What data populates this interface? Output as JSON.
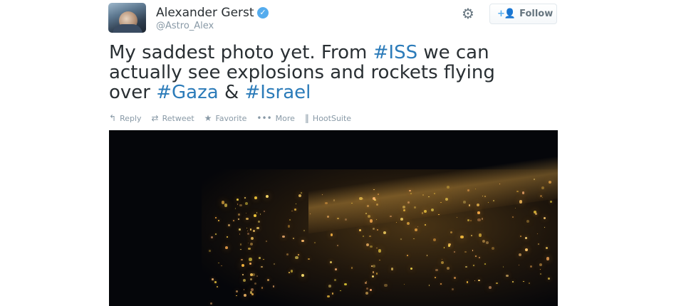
{
  "tweet": {
    "author_name": "Alexander Gerst",
    "handle": "@Astro_Alex",
    "verified_glyph": "✓",
    "gear_glyph": "⚙",
    "follow_icon": "+👤",
    "follow_label": "Follow",
    "text_lines": [
      {
        "plain1": "My saddest photo yet. From ",
        "tag1": "#ISS",
        "plain2": " we can"
      },
      {
        "plain1": "actually see explosions and rockets flying"
      },
      {
        "plain1": "over ",
        "tag1": "#Gaza",
        "plain2": " & ",
        "tag2": "#Israel"
      }
    ]
  },
  "actions": [
    {
      "name": "reply",
      "icon": "↰",
      "label": "Reply"
    },
    {
      "name": "retweet",
      "icon": "⇄",
      "label": "Retweet"
    },
    {
      "name": "favorite",
      "icon": "★",
      "label": "Favorite"
    },
    {
      "name": "more",
      "icon": "•••",
      "label": "More"
    },
    {
      "name": "hootsuite",
      "icon": "‖",
      "label": "HootSuite"
    }
  ],
  "colors": {
    "hashtag": "#2b7bb9",
    "verified": "#55acee",
    "muted": "#8899a6",
    "photo_bg": "#05060a"
  },
  "icons": [
    "verified-badge-icon",
    "gear-icon",
    "follow-person-icon",
    "reply-icon",
    "retweet-icon",
    "star-icon",
    "more-dots-icon",
    "hootsuite-icon"
  ]
}
